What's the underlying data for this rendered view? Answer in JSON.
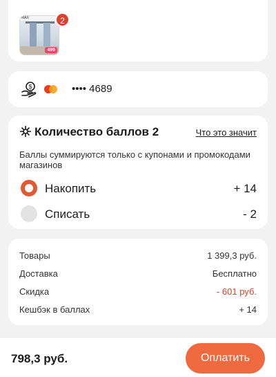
{
  "product": {
    "count_badge": "2",
    "price_tag": "499",
    "topbar_text": "MAX"
  },
  "payment": {
    "card_mask": "•••• 4689",
    "card_brand_icon": "mastercard-icon",
    "method_icon": "coin-hand-icon"
  },
  "points": {
    "title": "Количество баллов 2",
    "info_link": "Что это значит",
    "description": "Баллы суммируются только с купонами и промокодами магазинов",
    "options": [
      {
        "label": "Накопить",
        "value": "+ 14",
        "selected": true
      },
      {
        "label": "Списать",
        "value": "- 2",
        "selected": false
      }
    ]
  },
  "summary": {
    "rows": [
      {
        "key": "Товары",
        "value": "1 399,3 руб."
      },
      {
        "key": "Доставка",
        "value": "Бесплатно"
      },
      {
        "key": "Скидка",
        "value": "- 601 руб."
      },
      {
        "key": "Кешбэк в баллах",
        "value": "+ 14"
      }
    ]
  },
  "footer": {
    "total": "798,3 руб.",
    "pay_label": "Оплатить"
  },
  "colors": {
    "accent": "#ef6a3e",
    "discount": "#d9432e",
    "background": "#f2f2f2"
  }
}
